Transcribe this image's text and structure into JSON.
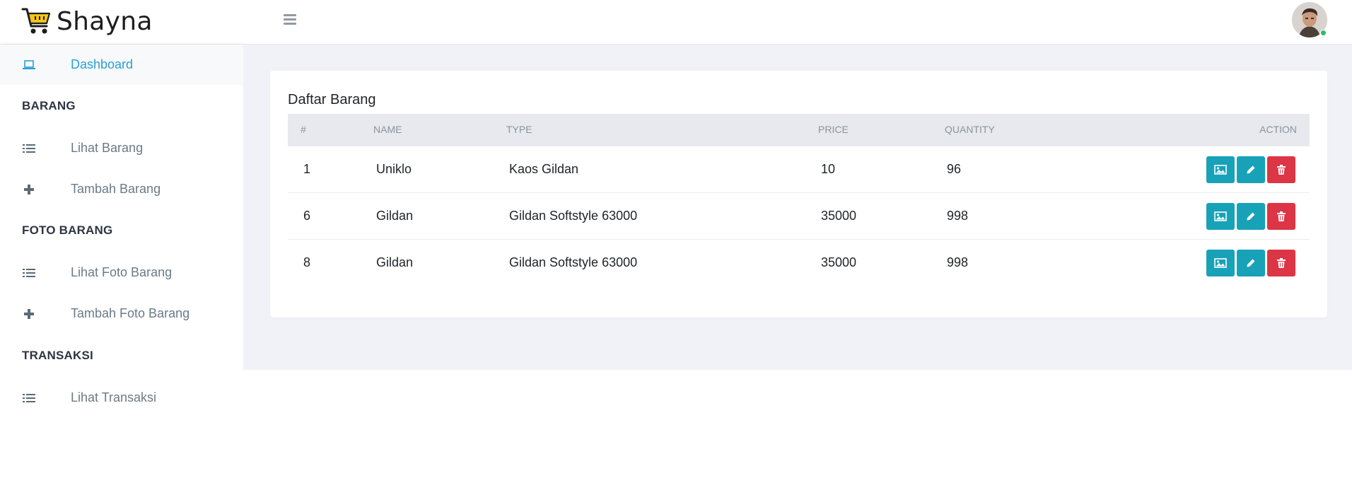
{
  "brand": {
    "name": "Shayna",
    "icon": "shopping-cart-icon",
    "accent": "#f5c518"
  },
  "header": {
    "menu_icon": "hamburger-icon",
    "avatar": "user-avatar",
    "status": "online"
  },
  "sidebar": {
    "dashboard": {
      "label": "Dashboard",
      "icon": "laptop-icon"
    },
    "sections": [
      {
        "title": "BARANG",
        "items": [
          {
            "label": "Lihat Barang",
            "icon": "list-icon"
          },
          {
            "label": "Tambah Barang",
            "icon": "plus-icon"
          }
        ]
      },
      {
        "title": "FOTO BARANG",
        "items": [
          {
            "label": "Lihat Foto Barang",
            "icon": "list-icon"
          },
          {
            "label": "Tambah Foto Barang",
            "icon": "plus-icon"
          }
        ]
      },
      {
        "title": "TRANSAKSI",
        "items": [
          {
            "label": "Lihat Transaksi",
            "icon": "list-icon"
          }
        ]
      }
    ]
  },
  "main": {
    "card_title": "Daftar Barang",
    "columns": [
      "#",
      "NAME",
      "TYPE",
      "PRICE",
      "QUANTITY",
      "ACTION"
    ],
    "rows": [
      {
        "id": "1",
        "name": "Uniklo",
        "type": "Kaos Gildan",
        "price": "10",
        "quantity": "96"
      },
      {
        "id": "6",
        "name": "Gildan",
        "type": "Gildan Softstyle 63000",
        "price": "35000",
        "quantity": "998"
      },
      {
        "id": "8",
        "name": "Gildan",
        "type": "Gildan Softstyle 63000",
        "price": "35000",
        "quantity": "998"
      }
    ],
    "action_icons": [
      "image-icon",
      "pencil-icon",
      "trash-icon"
    ]
  },
  "colors": {
    "primary": "#2a9fd6",
    "info": "#17a2b8",
    "danger": "#dc3545",
    "content_bg": "#f1f2f7"
  }
}
